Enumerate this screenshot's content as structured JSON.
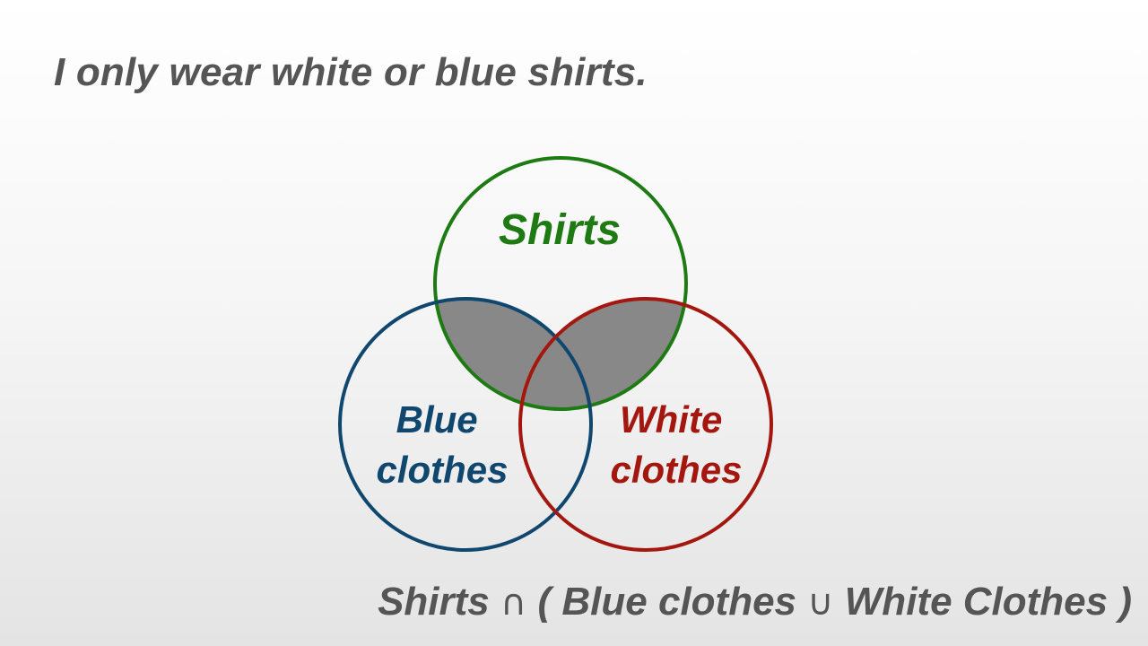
{
  "headline": "I only wear white or blue shirts.",
  "diagram": {
    "sets": [
      {
        "label_lines": [
          "Shirts"
        ],
        "color": "#1e7a12"
      },
      {
        "label_lines": [
          "Blue",
          "clothes"
        ],
        "color": "#10476f"
      },
      {
        "label_lines": [
          "White",
          "clothes"
        ],
        "color": "#a3170f"
      }
    ],
    "highlight": {
      "region": "Shirts ∩ (Blue clothes ∪ White clothes)",
      "fill_color": "#888888"
    }
  },
  "formula": {
    "part1": "Shirts",
    "intersection_symbol": "∩",
    "open_paren": "(",
    "set_a": "Blue clothes",
    "union_symbol": "∪",
    "set_b": "White Clothes",
    "close_paren": ")"
  }
}
